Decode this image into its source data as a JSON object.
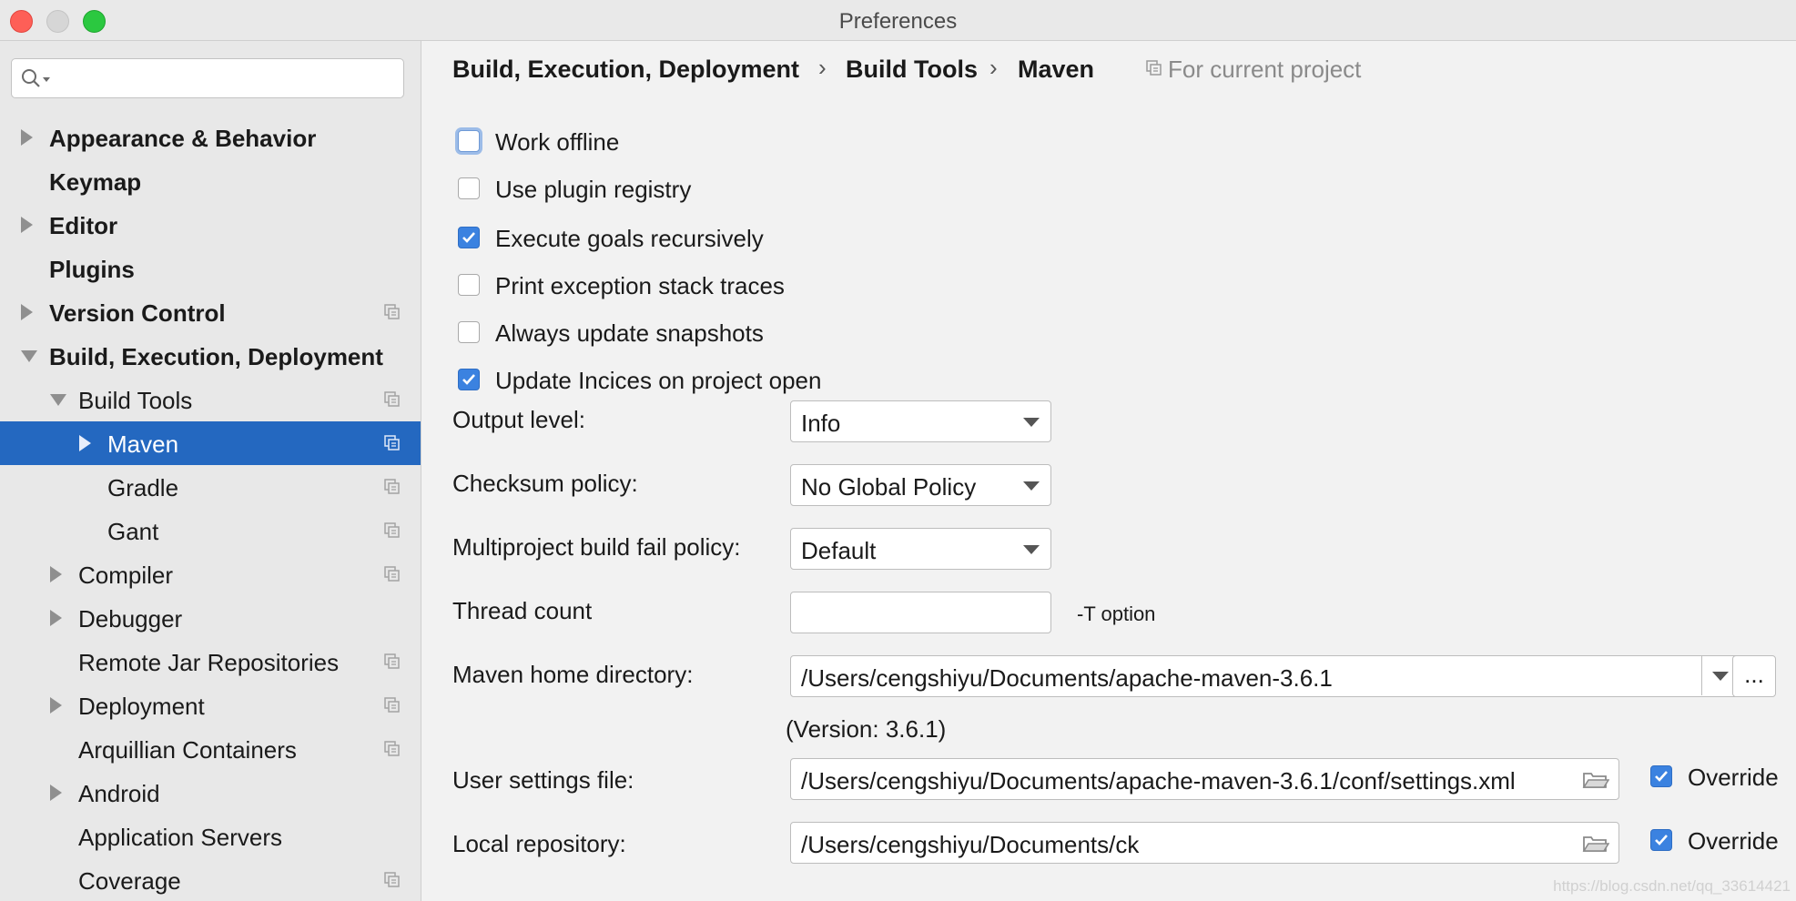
{
  "window": {
    "title": "Preferences"
  },
  "sidebar": {
    "search": {
      "value": "",
      "placeholder": ""
    },
    "items": [
      {
        "label": "Appearance & Behavior",
        "bold": true,
        "expander": "collapsed",
        "copy_icon": false
      },
      {
        "label": "Keymap",
        "bold": true,
        "expander": "none",
        "copy_icon": false
      },
      {
        "label": "Editor",
        "bold": true,
        "expander": "collapsed",
        "copy_icon": false
      },
      {
        "label": "Plugins",
        "bold": true,
        "expander": "none",
        "copy_icon": false
      },
      {
        "label": "Version Control",
        "bold": true,
        "expander": "collapsed",
        "copy_icon": true
      },
      {
        "label": "Build, Execution, Deployment",
        "bold": true,
        "expander": "expanded",
        "copy_icon": false
      },
      {
        "label": "Build Tools",
        "bold": false,
        "expander": "expanded",
        "copy_icon": true
      },
      {
        "label": "Maven",
        "bold": false,
        "expander": "collapsed",
        "copy_icon": true,
        "selected": true
      },
      {
        "label": "Gradle",
        "bold": false,
        "expander": "none",
        "copy_icon": true
      },
      {
        "label": "Gant",
        "bold": false,
        "expander": "none",
        "copy_icon": true
      },
      {
        "label": "Compiler",
        "bold": false,
        "expander": "collapsed",
        "copy_icon": true
      },
      {
        "label": "Debugger",
        "bold": false,
        "expander": "collapsed",
        "copy_icon": false
      },
      {
        "label": "Remote Jar Repositories",
        "bold": false,
        "expander": "none",
        "copy_icon": true
      },
      {
        "label": "Deployment",
        "bold": false,
        "expander": "collapsed",
        "copy_icon": true
      },
      {
        "label": "Arquillian Containers",
        "bold": false,
        "expander": "none",
        "copy_icon": true
      },
      {
        "label": "Android",
        "bold": false,
        "expander": "collapsed",
        "copy_icon": false
      },
      {
        "label": "Application Servers",
        "bold": false,
        "expander": "none",
        "copy_icon": false
      },
      {
        "label": "Coverage",
        "bold": false,
        "expander": "none",
        "copy_icon": true
      }
    ]
  },
  "breadcrumb": {
    "items": [
      "Build, Execution, Deployment",
      "Build Tools",
      "Maven"
    ],
    "separator": "›",
    "scope_label": "For current project"
  },
  "options": [
    {
      "label": "Work offline",
      "checked": false,
      "focused": true
    },
    {
      "label": "Use plugin registry",
      "checked": false
    },
    {
      "label": "Execute goals recursively",
      "checked": true
    },
    {
      "label": "Print exception stack traces",
      "checked": false
    },
    {
      "label": "Always update snapshots",
      "checked": false
    },
    {
      "label": "Update Incices on project open",
      "checked": true
    }
  ],
  "form": {
    "output_level": {
      "label": "Output level:",
      "value": "Info"
    },
    "checksum_policy": {
      "label": "Checksum policy:",
      "value": "No Global Policy"
    },
    "fail_policy": {
      "label": "Multiproject build fail policy:",
      "value": "Default"
    },
    "thread_count": {
      "label": "Thread count",
      "value": "",
      "hint": "-T option"
    },
    "maven_home": {
      "label": "Maven home directory:",
      "value": "/Users/cengshiyu/Documents/apache-maven-3.6.1",
      "browse_label": "...",
      "version": "(Version: 3.6.1)"
    },
    "user_settings": {
      "label": "User settings file:",
      "value": "/Users/cengshiyu/Documents/apache-maven-3.6.1/conf/settings.xml",
      "override_label": "Override",
      "override_checked": true
    },
    "local_repo": {
      "label": "Local repository:",
      "value": "/Users/cengshiyu/Documents/ck",
      "override_label": "Override",
      "override_checked": true
    }
  },
  "watermark": "https://blog.csdn.net/qq_33614421",
  "colors": {
    "selection": "#2468c0",
    "checkbox_checked": "#3b82e0",
    "close": "#fe5f57",
    "maximize": "#2bc840"
  }
}
